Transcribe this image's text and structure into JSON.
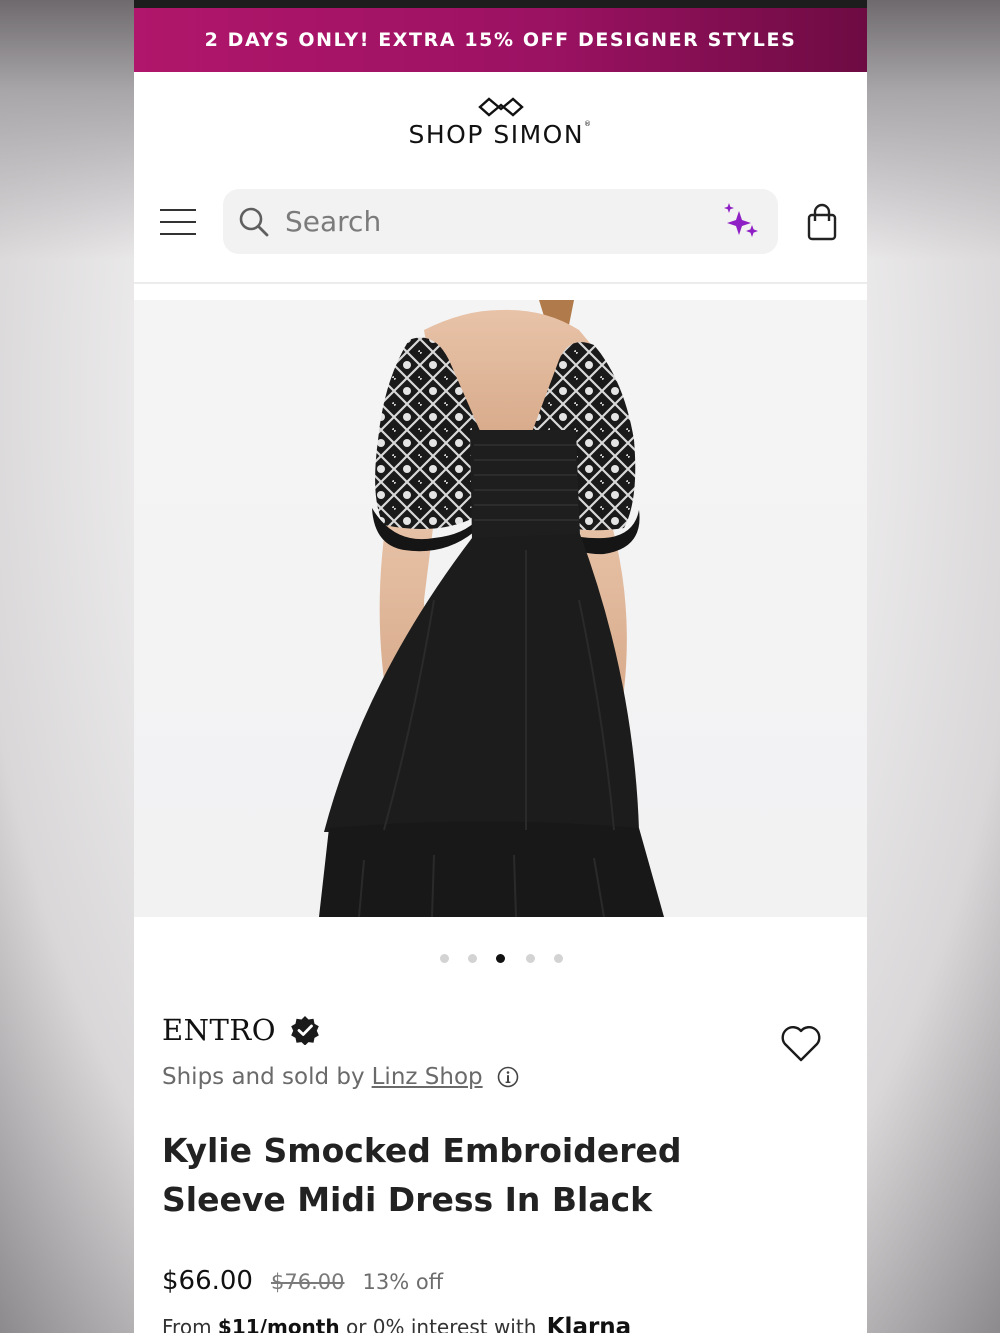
{
  "promo": {
    "text": "2 DAYS ONLY! EXTRA 15% OFF DESIGNER STYLES"
  },
  "header": {
    "logo_text": "SHOP SIMON",
    "search_placeholder": "Search"
  },
  "icons": {
    "menu": "hamburger-menu-icon",
    "search": "search-icon",
    "ai": "sparkle-icon",
    "cart": "shopping-bag-icon",
    "wishlist": "heart-icon",
    "verified": "verified-badge-icon",
    "info": "info-icon"
  },
  "colors": {
    "promo_start": "#b0166b",
    "promo_end": "#6e0b43",
    "sparkle": "#8e1fc4"
  },
  "carousel": {
    "total_images": 5,
    "active_index": 2
  },
  "product": {
    "brand": "ENTRO",
    "ships_prefix": "Ships and sold by",
    "seller": "Linz Shop",
    "title": "Kylie Smocked Embroidered Sleeve Midi Dress In Black",
    "price": "$66.00",
    "original_price": "$76.00",
    "discount": "13% off",
    "financing": {
      "prefix": "From",
      "amount": "$11/month",
      "middle": "or 0% interest with",
      "provider": "Klarna"
    }
  }
}
